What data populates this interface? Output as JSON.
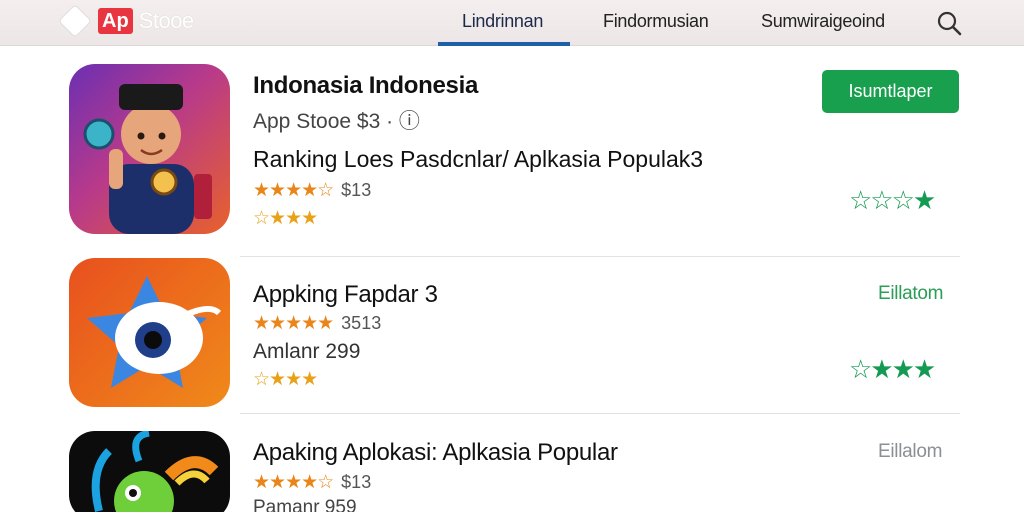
{
  "header": {
    "logo_badge": "Ap",
    "logo_text": "Stooe",
    "tabs": [
      {
        "label": "Lindrinnan",
        "active": true
      },
      {
        "label": "Findormusian",
        "active": false
      },
      {
        "label": "Sumwiraigeoind",
        "active": false
      }
    ],
    "search_icon": "search-icon"
  },
  "apps": [
    {
      "title": "Indonasia Indonesia",
      "subtitle": "App Stooe  $3 · ⓘ",
      "description": "Ranking Loes Pasdcnlar/ Aplkasia Populak3",
      "rating_stars": "★★★★☆",
      "rating_value": "$13",
      "secondary_stars": "☆★★★",
      "action_label": "Isumtlaper",
      "green_stars": "☆☆☆★"
    },
    {
      "title": "Appking Fapdar 3",
      "rating_stars": "★★★★★",
      "rating_value": "3513",
      "description": "Amlanr 299",
      "secondary_stars": "☆★★★",
      "action_label": "Eillatom",
      "green_stars": "☆★★★"
    },
    {
      "title": "Apaking Aplokasi: Aplkasia Popular",
      "rating_stars": "★★★★☆",
      "rating_value": "$13",
      "description": "Pamanr 959",
      "action_label": "Eillalom"
    }
  ],
  "colors": {
    "accent_blue": "#1f5fa8",
    "button_green": "#18a04e",
    "star_orange": "#e8861a",
    "badge_red": "#e8353f"
  }
}
